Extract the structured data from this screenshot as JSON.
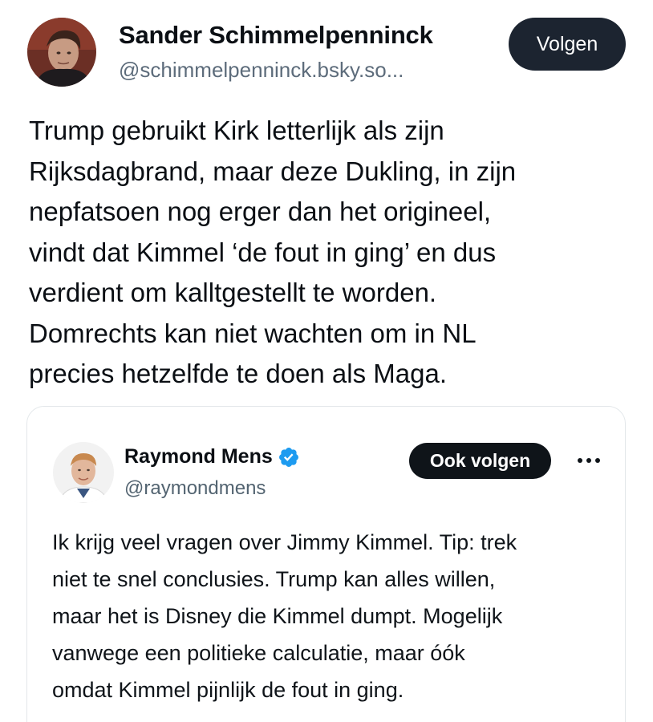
{
  "post": {
    "author": {
      "name": "Sander Schimmelpenninck",
      "handle": "@schimmelpenninck.bsky.so..."
    },
    "follow_label": "Volgen",
    "text": "Trump gebruikt Kirk letterlijk als zijn\nRijksdagbrand, maar deze Dukling, in zijn\nnepfatsoen nog erger dan het origineel,\nvindt dat Kimmel ‘de fout in ging’ en dus\nverdient om kalltgestellt te worden.\nDomrechts kan niet wachten om in NL\nprecies hetzelfde te doen als Maga."
  },
  "quote": {
    "author": {
      "name": "Raymond Mens",
      "handle": "@raymondmens",
      "verified": true
    },
    "follow_label": "Ook volgen",
    "more_icon": "more-dots-icon",
    "text": "Ik krijg veel vragen over Jimmy Kimmel. Tip: trek\nniet te snel conclusies. Trump kan alles willen,\nmaar het is Disney die Kimmel dumpt. Mogelijk\nvanwege een politieke calculatie, maar óók\nomdat Kimmel pijnlijk de fout in ging."
  },
  "colors": {
    "follow_button_bg": "#1c2430",
    "quote_follow_button_bg": "#0f1419",
    "verified_badge": "#1d9bf0",
    "handle_gray": "#5d6c7b"
  }
}
